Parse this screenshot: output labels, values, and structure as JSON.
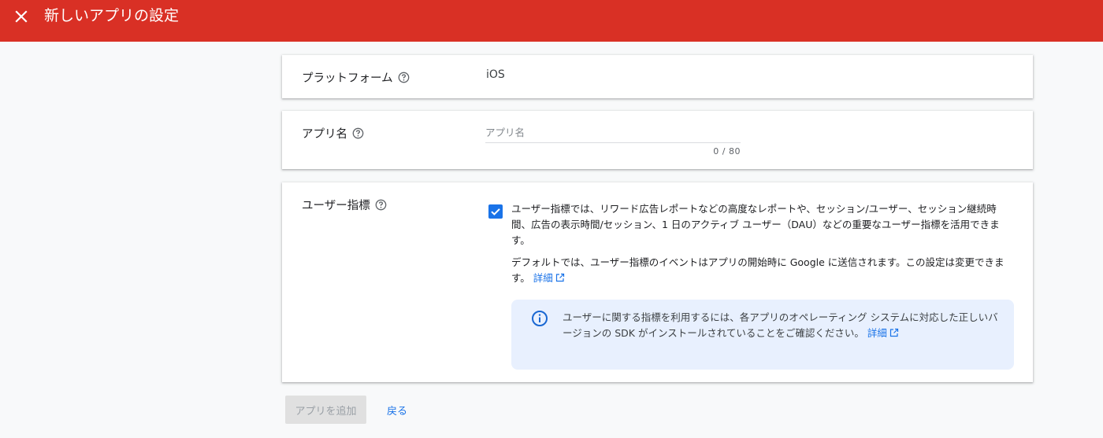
{
  "header": {
    "title": "新しいアプリの設定",
    "close_icon": "close-icon",
    "background_color": "#d93025"
  },
  "platform": {
    "label": "プラットフォーム",
    "value": "iOS",
    "help_icon": "help-circle-icon"
  },
  "app_name": {
    "label": "アプリ名",
    "placeholder": "アプリ名",
    "value": "",
    "char_count": "0 / 80",
    "help_icon": "help-circle-icon"
  },
  "user_metrics": {
    "label": "ユーザー指標",
    "help_icon": "help-circle-icon",
    "checked": true,
    "description": "ユーザー指標では、リワード広告レポートなどの高度なレポートや、セッション/ユーザー、セッション継続時間、広告の表示時間/セッション、1 日のアクティブ ユーザー（DAU）などの重要なユーザー指標を活用できます。",
    "default_text": "デフォルトでは、ユーザー指標のイベントはアプリの開始時に Google に送信されます。この設定は変更できます。",
    "details_link": "詳細",
    "info": {
      "icon": "info-icon",
      "text": "ユーザーに関する指標を利用するには、各アプリのオペレーティング システムに対応した正しいバージョンの SDK がインストールされていることをご確認ください。",
      "details_link": "詳細"
    }
  },
  "actions": {
    "add_app_label": "アプリを追加",
    "back_label": "戻る"
  },
  "colors": {
    "accent": "#1a73e8",
    "info_background": "#e8f0fe"
  }
}
